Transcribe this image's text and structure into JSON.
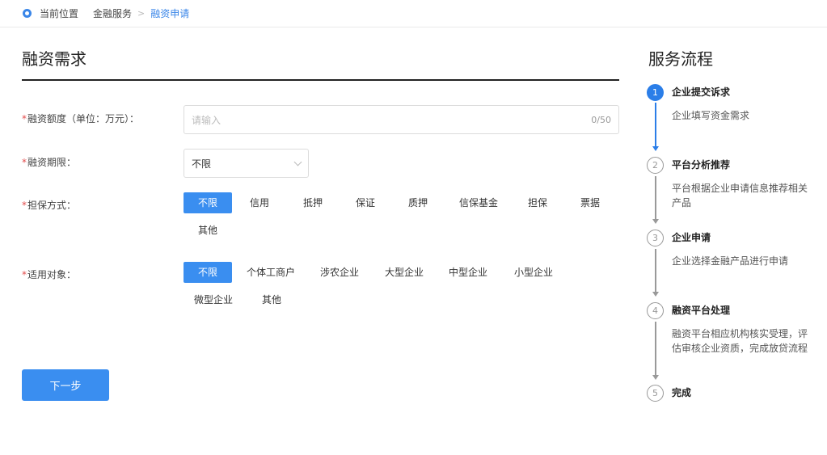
{
  "breadcrumb": {
    "label": "当前位置",
    "items": [
      "金融服务"
    ],
    "current": "融资申请"
  },
  "form": {
    "title": "融资需求",
    "amount": {
      "label": "融资额度（单位：万元）：",
      "placeholder": "请输入",
      "counter": "0/50"
    },
    "period": {
      "label": "融资期限：",
      "selected": "不限"
    },
    "guarantee": {
      "label": "担保方式：",
      "options": [
        "不限",
        "信用",
        "抵押",
        "保证",
        "质押",
        "信保基金",
        "担保",
        "票据",
        "其他"
      ],
      "selected_index": 0
    },
    "target": {
      "label": "适用对象：",
      "options": [
        "不限",
        "个体工商户",
        "涉农企业",
        "大型企业",
        "中型企业",
        "小型企业",
        "微型企业",
        "其他"
      ],
      "selected_index": 0
    },
    "required_mark": "*",
    "next_button": "下一步"
  },
  "flow": {
    "title": "服务流程",
    "steps": [
      {
        "num": "1",
        "title": "企业提交诉求",
        "desc": "企业填写资金需求",
        "active": true
      },
      {
        "num": "2",
        "title": "平台分析推荐",
        "desc": "平台根据企业申请信息推荐相关产品",
        "active": false
      },
      {
        "num": "3",
        "title": "企业申请",
        "desc": "企业选择金融产品进行申请",
        "active": false
      },
      {
        "num": "4",
        "title": "融资平台处理",
        "desc": "融资平台相应机构核实受理，评估审核企业资质，完成放贷流程",
        "active": false
      },
      {
        "num": "5",
        "title": "完成",
        "desc": "",
        "active": false
      }
    ]
  },
  "colors": {
    "accent": "#3a8ef0",
    "required": "#e34c4c"
  }
}
